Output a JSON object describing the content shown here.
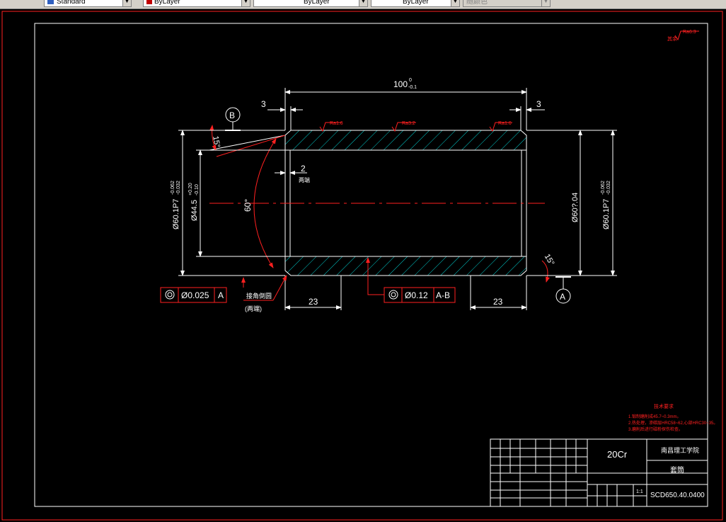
{
  "toolbar": {
    "textstyle": "Standard",
    "color": "ByLayer",
    "linetype": "ByLayer",
    "lineweight": "ByLayer",
    "plotstyle": "随颜色"
  },
  "drawing": {
    "overall_length": "100",
    "tol_upper": "0",
    "tol_lower": "-0.1",
    "chamfer_left": "3",
    "chamfer_right": "3",
    "datum_b": "B",
    "datum_a": "A",
    "angle_left": "15°",
    "angle_right": "15°",
    "angle_center": "60°",
    "roughness_left": "Ra1.6",
    "roughness_mid": "Ra3.2",
    "roughness_right": "Ra1.6",
    "roughness_rest": "Ra6.3",
    "rest_prefix": "其余",
    "dim_2": "2",
    "dim_2_note": "两端",
    "bore_dia": "Ø44.5",
    "bore_tol_upper": "+0.20",
    "bore_tol_lower": "-0.10",
    "outer_left": "Ø60.1P7",
    "outer_right": "Ø60.1P7",
    "outer_tol_upper": "-0.062",
    "outer_tol_lower": "-0.032",
    "outer_mid": "Ø60?.04",
    "fcf_left_value": "Ø0.025",
    "fcf_left_datum": "A",
    "fcf_mid_value": "Ø0.12",
    "fcf_mid_datum": "A-B",
    "note_chamfer": "接角倒圆",
    "note_both": "(两端)",
    "len_left": "23",
    "len_right": "23"
  },
  "notes": {
    "title": "技术要求",
    "line1": "1.锻制磨削成45.7~0.3mm。",
    "line2": "2.热处理，渗碳层HRC58~62,心部HRC30~35。",
    "line3": "3.磨削后进行磁粉探伤检查。"
  },
  "titleblock": {
    "material": "20Cr",
    "school": "南昌理工学院",
    "part_name": "套筒",
    "drawing_no": "SCD650.40.0400",
    "scale": "1:1"
  },
  "colors": {
    "frame": "#ff2020",
    "geometry": "#ffffff",
    "hatch": "#00d0d0",
    "dimension": "#ffffff",
    "background": "#000000"
  }
}
